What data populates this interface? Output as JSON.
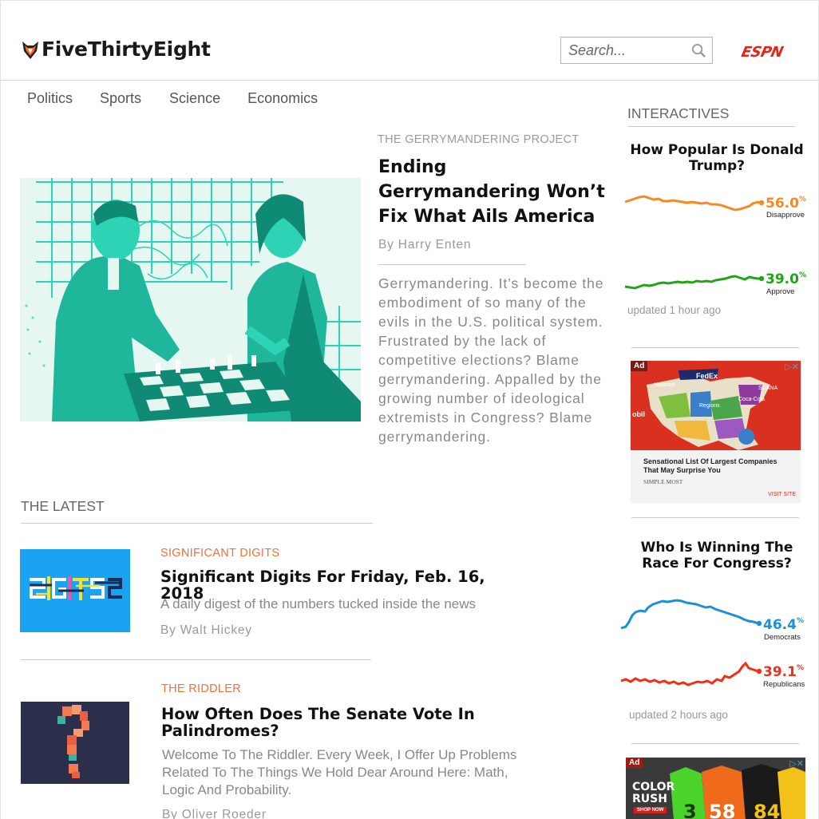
{
  "header": {
    "logo_text": "FiveThirtyEight",
    "search_placeholder": "Search...",
    "espn_label": "ESPN"
  },
  "nav": {
    "items": [
      "Politics",
      "Sports",
      "Science",
      "Economics"
    ]
  },
  "feature": {
    "kicker": "THE GERRYMANDERING PROJECT",
    "title": "Ending Gerrymandering Won’t Fix What Ails America",
    "byline": "By Harry Enten",
    "dek": "Gerrymandering. It’s become the embodiment of so many of the evils in the U.S. political system. Frustrated by the lack of competitive elections? Blame gerrymandering. Appalled by the growing number of ideological extremists in Congress? Blame gerrymandering.",
    "image_icon": "chess-players-illustration"
  },
  "latest": {
    "heading": "THE LATEST",
    "stories": [
      {
        "kicker": "SIGNIFICANT DIGITS",
        "title": "Significant Digits For Friday, Feb. 16, 2018",
        "dek": "A daily digest of the numbers tucked inside the news",
        "byline": "By Walt Hickey",
        "thumb_text": "DIGITS"
      },
      {
        "kicker": "THE RIDDLER",
        "title": "How Often Does The Senate Vote In Palindromes?",
        "dek": "Welcome To The Riddler. Every Week, I Offer Up Problems Related To The Things We Hold Dear Around Here: Math, Logic And Probability.",
        "byline": "By Oliver Roeder",
        "thumb_icon": "question-mark-illustration"
      }
    ]
  },
  "sidebar": {
    "heading": "INTERACTIVES",
    "approval": {
      "title": "How Popular Is Donald Trump?",
      "disapprove_value": "56.0",
      "disapprove_label": "Disapprove",
      "approve_value": "39.0",
      "approve_label": "Approve",
      "pct_sign": "%",
      "updated": "updated 1 hour ago",
      "disapprove_color": "#f98722",
      "approve_color": "#1fa616"
    },
    "ad1": {
      "tag": "Ad",
      "headline": "Sensational List Of Largest Companies That May Surprise You",
      "source": "SIMPLE MOST",
      "cta": "VISIT SITE",
      "map_labels": [
        "FedEx",
        "Walmart",
        "Coca-Cola",
        "SCANA",
        "Regions"
      ],
      "side_text": "obil"
    },
    "congress": {
      "title": "Who Is Winning The Race For Congress?",
      "dem_value": "46.4",
      "dem_label": "Democrats",
      "rep_value": "39.1",
      "rep_label": "Republicans",
      "pct_sign": "%",
      "updated": "updated 2 hours ago",
      "dem_color": "#1a90d8",
      "rep_color": "#f52d14"
    },
    "ad2": {
      "tag": "Ad",
      "headline": "COLOR RUSH",
      "cta": "SHOP NOW",
      "jersey_numbers": [
        "3",
        "58",
        "84"
      ]
    }
  }
}
